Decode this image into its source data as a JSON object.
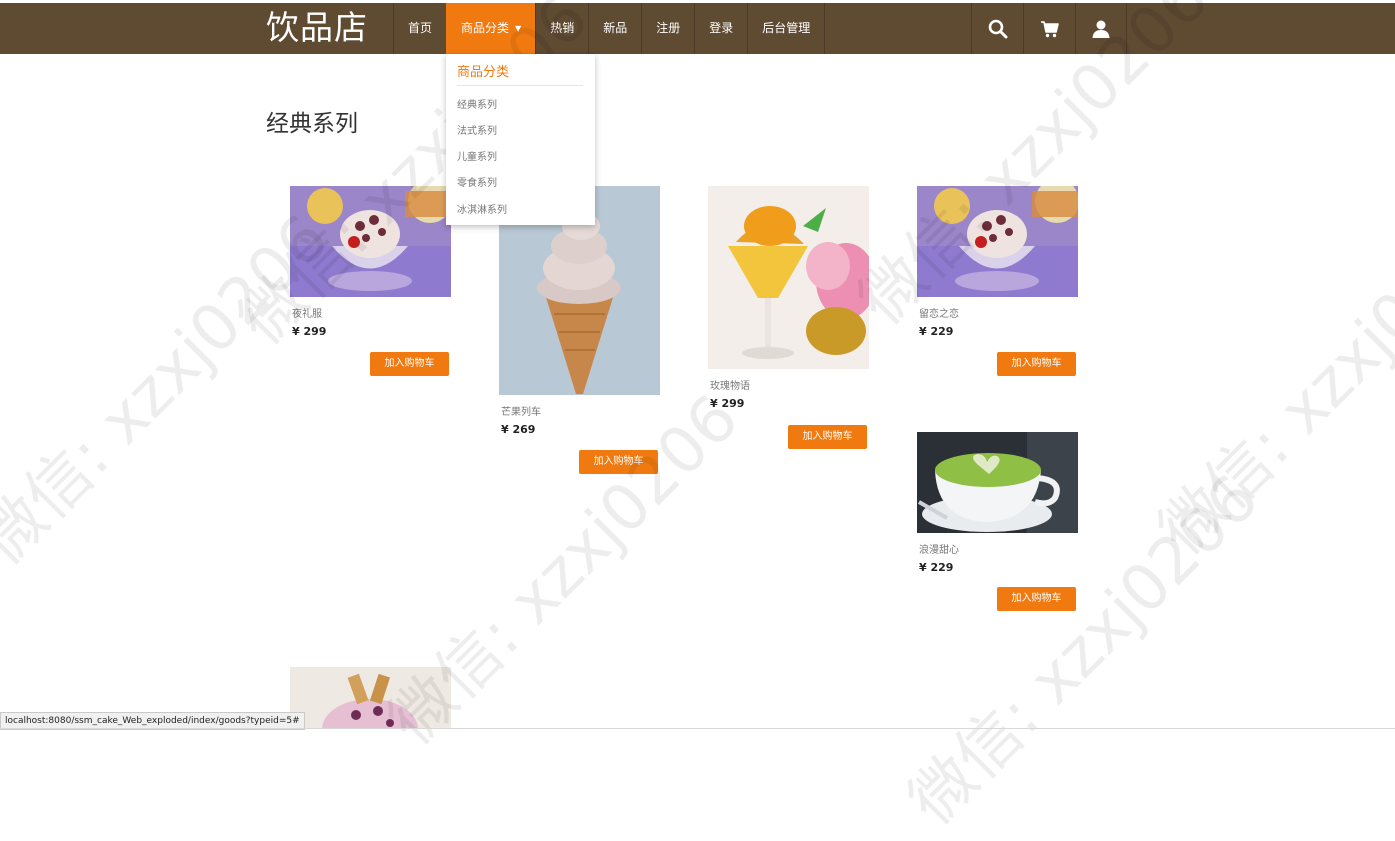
{
  "header": {
    "logo": "饮品店",
    "nav": [
      {
        "label": "首页"
      },
      {
        "label": "商品分类",
        "active": true
      },
      {
        "label": "热销"
      },
      {
        "label": "新品"
      },
      {
        "label": "注册"
      },
      {
        "label": "登录"
      },
      {
        "label": "后台管理"
      }
    ],
    "icons": [
      "search-icon",
      "cart-icon",
      "user-icon"
    ]
  },
  "dropdown": {
    "title": "商品分类",
    "items": [
      "经典系列",
      "法式系列",
      "儿童系列",
      "零食系列",
      "冰淇淋系列"
    ]
  },
  "section": {
    "title": "经典系列"
  },
  "products": [
    {
      "name": "夜礼服",
      "price": "¥ 299",
      "button": "加入购物车"
    },
    {
      "name": "芒果列车",
      "price": "¥ 269",
      "button": "加入购物车"
    },
    {
      "name": "玫瑰物语",
      "price": "¥ 299",
      "button": "加入购物车"
    },
    {
      "name": "留恋之恋",
      "price": "¥ 229",
      "button": "加入购物车"
    },
    {
      "name": "浪漫甜心",
      "price": "¥ 229",
      "button": "加入购物车"
    }
  ],
  "status_bar": {
    "url": "localhost:8080/ssm_cake_Web_exploded/index/goods?typeid=5#"
  },
  "colors": {
    "header_bg": "#5f4a32",
    "accent": "#f07a10"
  },
  "watermark": "微信: xzxj0206"
}
